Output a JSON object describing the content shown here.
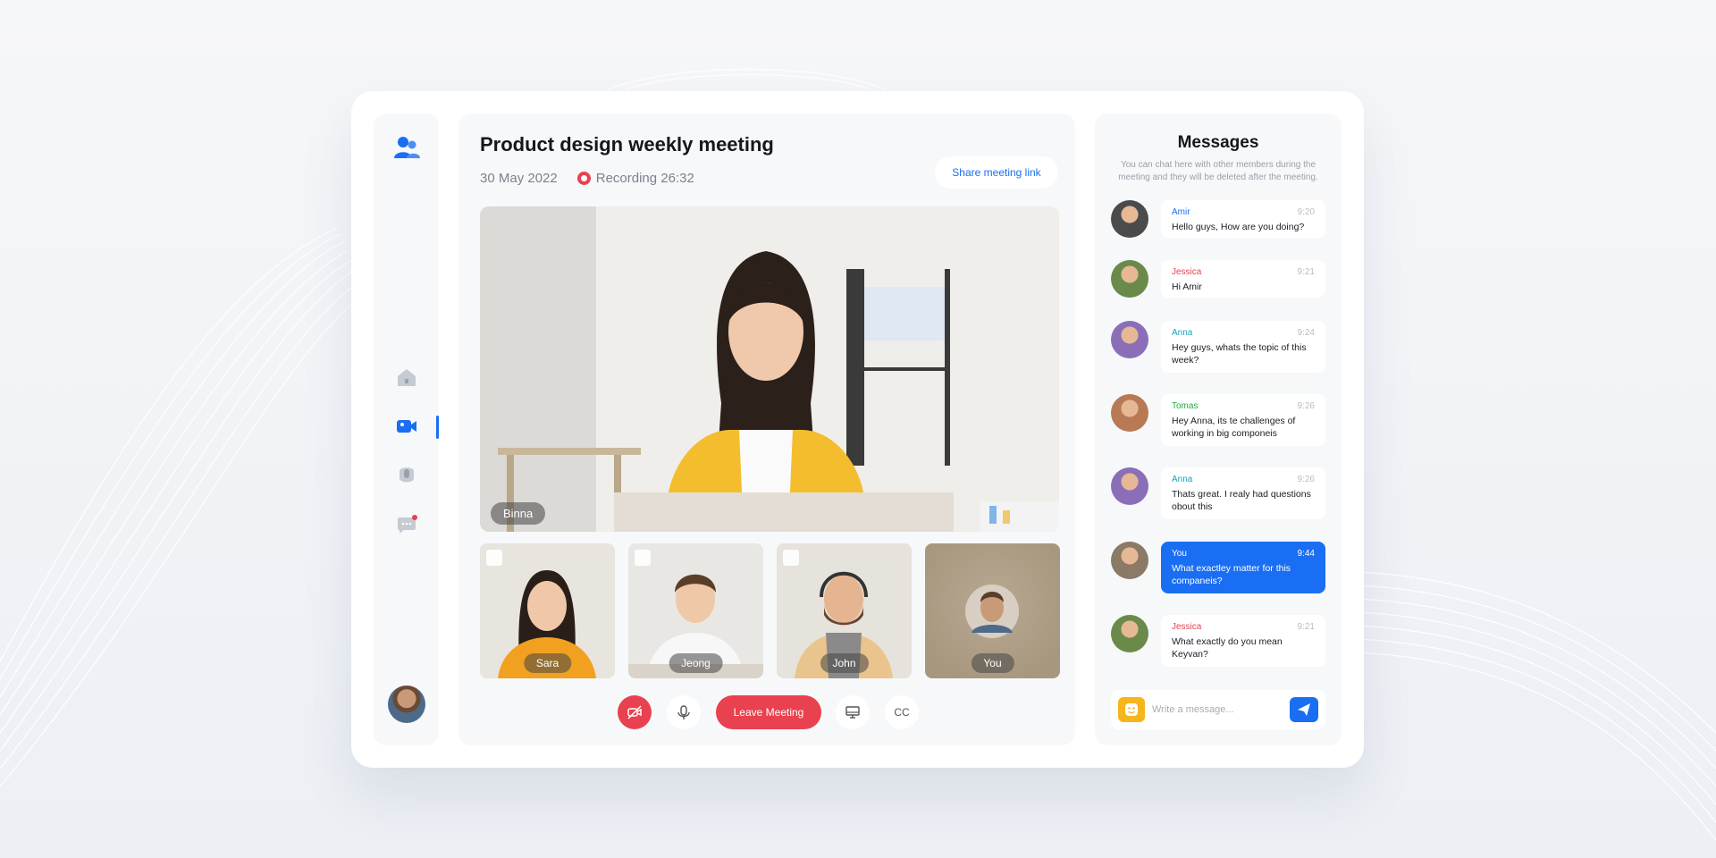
{
  "meeting": {
    "title": "Product design weekly meeting",
    "date": "30 May 2022",
    "recording": "Recording 26:32",
    "share_label": "Share meeting link"
  },
  "main_video": {
    "label": "Binna"
  },
  "participants": [
    {
      "label": "Sara"
    },
    {
      "label": "Jeong"
    },
    {
      "label": "John"
    },
    {
      "label": "You"
    }
  ],
  "controls": {
    "leave_label": "Leave Meeting",
    "cc_label": "CC"
  },
  "messages_panel": {
    "title": "Messages",
    "description": "You can chat here with other members during the meeting and they will be deleted after the meeting.",
    "input_placeholder": "Write a message..."
  },
  "messages": [
    {
      "name": "Amir",
      "time": "9:20",
      "text": "Hello guys, How are you doing?",
      "color": "#1a6ef3"
    },
    {
      "name": "Jessica",
      "time": "9:21",
      "text": "Hi Amir",
      "color": "#e9414f"
    },
    {
      "name": "Anna",
      "time": "9:24",
      "text": "Hey guys, whats the topic of this week?",
      "color": "#17a2b8"
    },
    {
      "name": "Tomas",
      "time": "9:26",
      "text": "Hey Anna, its te challenges of working in big componeis",
      "color": "#28a745"
    },
    {
      "name": "Anna",
      "time": "9:26",
      "text": "Thats great. I realy had questions obout this",
      "color": "#17a2b8"
    },
    {
      "name": "You",
      "time": "9:44",
      "text": "What exactley matter for this companeis?",
      "color": "#ffffff"
    },
    {
      "name": "Jessica",
      "time": "9:21",
      "text": "What exactly do you mean Keyvan?",
      "color": "#e9414f"
    }
  ],
  "colors": {
    "accent": "#1a6ef3",
    "danger": "#e9414f",
    "emoji": "#f5b51d"
  }
}
